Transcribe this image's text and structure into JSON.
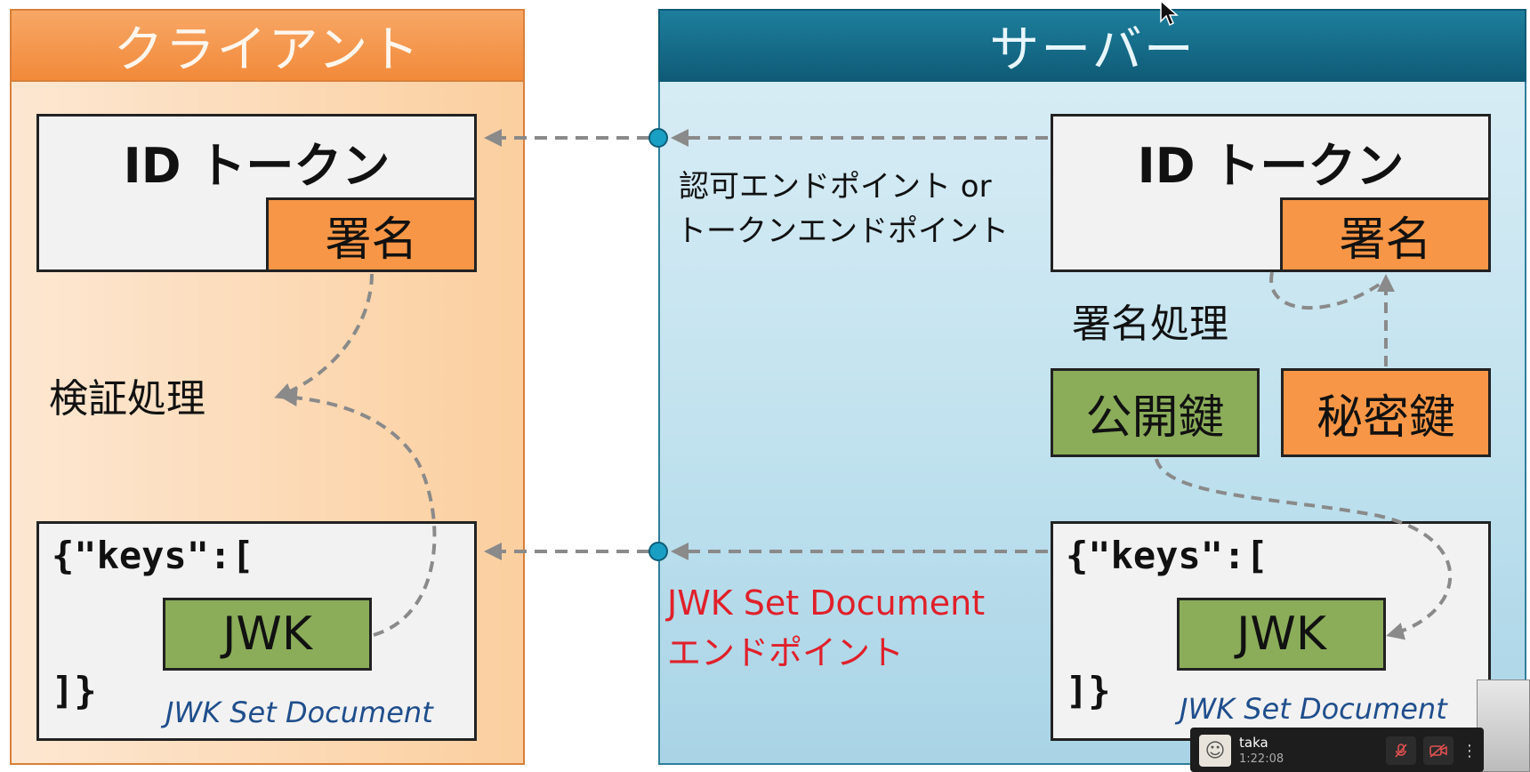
{
  "client": {
    "header": "クライアント",
    "id_token": {
      "title": "ID トークン",
      "signature": "署名"
    },
    "verify_label": "検証処理",
    "jwk_set": {
      "open": "{\"keys\":[",
      "jwk": "JWK",
      "close": "]}",
      "caption": "JWK Set Document"
    }
  },
  "server": {
    "header": "サーバー",
    "id_token": {
      "title": "ID トークン",
      "signature": "署名"
    },
    "sign_label": "署名処理",
    "public_key": "公開鍵",
    "private_key": "秘密鍵",
    "jwk_set": {
      "open": "{\"keys\":[",
      "jwk": "JWK",
      "close": "]}",
      "caption": "JWK Set Document"
    }
  },
  "endpoints": {
    "token_endpoint_line1": "認可エンドポイント or",
    "token_endpoint_line2": "トークンエンドポイント",
    "jwks_line1": "JWK Set Document",
    "jwks_line2": "エンドポイント"
  },
  "colors": {
    "client_accent": "#f28a3a",
    "server_accent": "#0f5b77",
    "signature_fill": "#f79646",
    "key_fill": "#8bad5a",
    "arrow": "#8a8a8a",
    "endpoint_dot": "#1a9fc4",
    "jwks_label": "#e0202a"
  },
  "call_overlay": {
    "user": "taka",
    "elapsed": "1:22:08",
    "icons": [
      "mic-muted-icon",
      "camera-off-icon",
      "more-icon"
    ]
  }
}
